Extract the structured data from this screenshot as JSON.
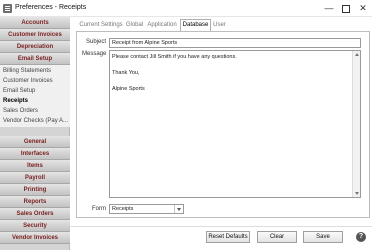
{
  "window": {
    "title": "Preferences - Receipts",
    "min_glyph": "—",
    "close_glyph": "✕"
  },
  "sidebar": {
    "top_sections": [
      "Accounts",
      "Customer Invoices",
      "Depreciation",
      "Email Setup"
    ],
    "email_setup_items": [
      "Billing Statements",
      "Customer Invoices",
      "Email Setup",
      "Receipts",
      "Sales Orders",
      "Vendor Checks (Pay A..."
    ],
    "selected_item": "Receipts",
    "bottom_sections": [
      "General",
      "Interfaces",
      "Items",
      "Payroll",
      "Printing",
      "Reports",
      "Sales Orders",
      "Security",
      "Vendor Invoices"
    ]
  },
  "tabs": [
    "Current Settings",
    "Global",
    "Application",
    "Database",
    "User"
  ],
  "active_tab": "Database",
  "form": {
    "subject_label": "Subject",
    "subject_value": "Receipt from Alpine Sports",
    "message_label": "Message",
    "message_value": "Please contact Jill Smith if you have any questions.\n\nThank You,\n\nAlpine Sports",
    "form_label": "Form",
    "form_value": "Receipts"
  },
  "buttons": {
    "reset": "Reset Defaults",
    "clear": "Clear",
    "save": "Save",
    "help_glyph": "?"
  },
  "icons": {
    "app": "app-icon",
    "help": "help-icon",
    "dropdown": "chevron-down-icon"
  }
}
